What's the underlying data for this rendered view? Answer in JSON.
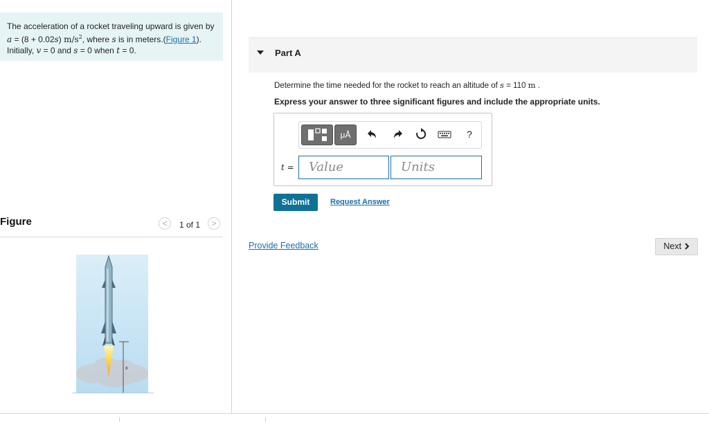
{
  "problem": {
    "line1": "The acceleration of a rocket traveling upward is given by",
    "line2_a": "a",
    "line2_b": " = (8 + 0.02",
    "line2_c": "s",
    "line2_d": ") ",
    "line2_unit": "m/s",
    "line2_e": ", where ",
    "line2_f": "s",
    "line2_g": " is in meters.(",
    "line2_link": "Figure 1",
    "line2_h": ").",
    "line3_a": "Initially, ",
    "line3_b": "v",
    "line3_c": " = 0 and ",
    "line3_d": "s",
    "line3_e": " = 0 when ",
    "line3_f": "t",
    "line3_g": " = 0."
  },
  "figure": {
    "title": "Figure",
    "pager_text": "1 of 1",
    "prev_glyph": "<",
    "next_glyph": ">",
    "var_label": "s"
  },
  "part": {
    "title": "Part A",
    "question_a": "Determine the time needed for the rocket to reach an altitude of ",
    "question_var": "s",
    "question_b": " = 110 ",
    "question_unit": "m",
    "question_c": " .",
    "instruction": "Express your answer to three significant figures and include the appropriate units."
  },
  "answer": {
    "var_label": "t =",
    "value_placeholder": "Value",
    "units_placeholder": "Units",
    "units_btn_label": "μÅ",
    "help_glyph": "?"
  },
  "actions": {
    "submit": "Submit",
    "request_answer": "Request Answer",
    "provide_feedback": "Provide Feedback",
    "next": "Next"
  },
  "colors": {
    "problem_bg": "#e6f4f6",
    "link": "#1a6fa8",
    "submit_bg": "#0f7196",
    "toolbar_btn": "#6f6f6f"
  }
}
